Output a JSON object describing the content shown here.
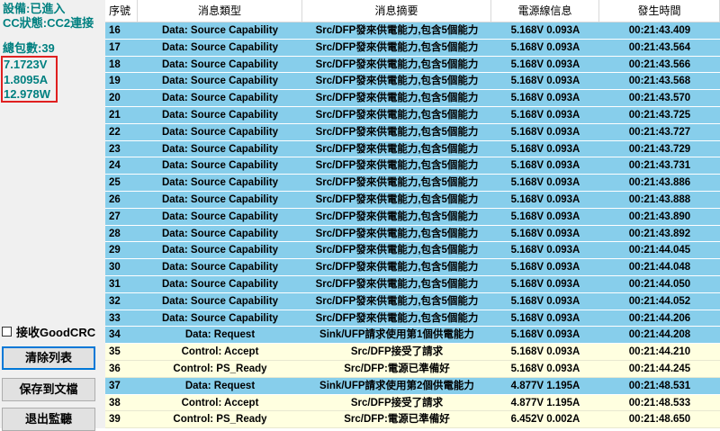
{
  "status": {
    "device": "設備:已進入",
    "cc_state": "CC狀態:CC2連接",
    "packet_count": "總包數:39"
  },
  "measurements": {
    "voltage": "7.1723V",
    "current": "1.8095A",
    "power": "12.978W"
  },
  "controls": {
    "receive_goodcrc_label": "接收GoodCRC",
    "receive_goodcrc_checked": false,
    "clear_list_label": "清除列表",
    "save_to_file_label": "保存到文檔",
    "exit_monitor_label": "退出監聽"
  },
  "colors": {
    "row_blue": "#87ceeb",
    "row_cream": "#ffffe0",
    "status_teal": "#008080",
    "highlight_red": "#e02020"
  },
  "table": {
    "columns": [
      "序號",
      "消息類型",
      "消息摘要",
      "電源線信息",
      "發生時間"
    ],
    "rows": [
      {
        "id": "16",
        "type": "Data: Source Capability",
        "summary": "Src/DFP發來供電能力,包含5個能力",
        "power": "5.168V 0.093A",
        "time": "00:21:43.409",
        "tone": "blue"
      },
      {
        "id": "17",
        "type": "Data: Source Capability",
        "summary": "Src/DFP發來供電能力,包含5個能力",
        "power": "5.168V 0.093A",
        "time": "00:21:43.564",
        "tone": "blue"
      },
      {
        "id": "18",
        "type": "Data: Source Capability",
        "summary": "Src/DFP發來供電能力,包含5個能力",
        "power": "5.168V 0.093A",
        "time": "00:21:43.566",
        "tone": "blue"
      },
      {
        "id": "19",
        "type": "Data: Source Capability",
        "summary": "Src/DFP發來供電能力,包含5個能力",
        "power": "5.168V 0.093A",
        "time": "00:21:43.568",
        "tone": "blue"
      },
      {
        "id": "20",
        "type": "Data: Source Capability",
        "summary": "Src/DFP發來供電能力,包含5個能力",
        "power": "5.168V 0.093A",
        "time": "00:21:43.570",
        "tone": "blue"
      },
      {
        "id": "21",
        "type": "Data: Source Capability",
        "summary": "Src/DFP發來供電能力,包含5個能力",
        "power": "5.168V 0.093A",
        "time": "00:21:43.725",
        "tone": "blue"
      },
      {
        "id": "22",
        "type": "Data: Source Capability",
        "summary": "Src/DFP發來供電能力,包含5個能力",
        "power": "5.168V 0.093A",
        "time": "00:21:43.727",
        "tone": "blue"
      },
      {
        "id": "23",
        "type": "Data: Source Capability",
        "summary": "Src/DFP發來供電能力,包含5個能力",
        "power": "5.168V 0.093A",
        "time": "00:21:43.729",
        "tone": "blue"
      },
      {
        "id": "24",
        "type": "Data: Source Capability",
        "summary": "Src/DFP發來供電能力,包含5個能力",
        "power": "5.168V 0.093A",
        "time": "00:21:43.731",
        "tone": "blue"
      },
      {
        "id": "25",
        "type": "Data: Source Capability",
        "summary": "Src/DFP發來供電能力,包含5個能力",
        "power": "5.168V 0.093A",
        "time": "00:21:43.886",
        "tone": "blue"
      },
      {
        "id": "26",
        "type": "Data: Source Capability",
        "summary": "Src/DFP發來供電能力,包含5個能力",
        "power": "5.168V 0.093A",
        "time": "00:21:43.888",
        "tone": "blue"
      },
      {
        "id": "27",
        "type": "Data: Source Capability",
        "summary": "Src/DFP發來供電能力,包含5個能力",
        "power": "5.168V 0.093A",
        "time": "00:21:43.890",
        "tone": "blue"
      },
      {
        "id": "28",
        "type": "Data: Source Capability",
        "summary": "Src/DFP發來供電能力,包含5個能力",
        "power": "5.168V 0.093A",
        "time": "00:21:43.892",
        "tone": "blue"
      },
      {
        "id": "29",
        "type": "Data: Source Capability",
        "summary": "Src/DFP發來供電能力,包含5個能力",
        "power": "5.168V 0.093A",
        "time": "00:21:44.045",
        "tone": "blue"
      },
      {
        "id": "30",
        "type": "Data: Source Capability",
        "summary": "Src/DFP發來供電能力,包含5個能力",
        "power": "5.168V 0.093A",
        "time": "00:21:44.048",
        "tone": "blue"
      },
      {
        "id": "31",
        "type": "Data: Source Capability",
        "summary": "Src/DFP發來供電能力,包含5個能力",
        "power": "5.168V 0.093A",
        "time": "00:21:44.050",
        "tone": "blue"
      },
      {
        "id": "32",
        "type": "Data: Source Capability",
        "summary": "Src/DFP發來供電能力,包含5個能力",
        "power": "5.168V 0.093A",
        "time": "00:21:44.052",
        "tone": "blue"
      },
      {
        "id": "33",
        "type": "Data: Source Capability",
        "summary": "Src/DFP發來供電能力,包含5個能力",
        "power": "5.168V 0.093A",
        "time": "00:21:44.206",
        "tone": "blue"
      },
      {
        "id": "34",
        "type": "Data: Request",
        "summary": "Sink/UFP請求使用第1個供電能力",
        "power": "5.168V 0.093A",
        "time": "00:21:44.208",
        "tone": "blue"
      },
      {
        "id": "35",
        "type": "Control: Accept",
        "summary": "Src/DFP接受了請求",
        "power": "5.168V 0.093A",
        "time": "00:21:44.210",
        "tone": "cream"
      },
      {
        "id": "36",
        "type": "Control: PS_Ready",
        "summary": "Src/DFP:電源已準備好",
        "power": "5.168V 0.093A",
        "time": "00:21:44.245",
        "tone": "cream"
      },
      {
        "id": "37",
        "type": "Data: Request",
        "summary": "Sink/UFP請求使用第2個供電能力",
        "power": "4.877V 1.195A",
        "time": "00:21:48.531",
        "tone": "blue"
      },
      {
        "id": "38",
        "type": "Control: Accept",
        "summary": "Src/DFP接受了請求",
        "power": "4.877V 1.195A",
        "time": "00:21:48.533",
        "tone": "cream"
      },
      {
        "id": "39",
        "type": "Control: PS_Ready",
        "summary": "Src/DFP:電源已準備好",
        "power": "6.452V 0.002A",
        "time": "00:21:48.650",
        "tone": "cream"
      }
    ]
  }
}
